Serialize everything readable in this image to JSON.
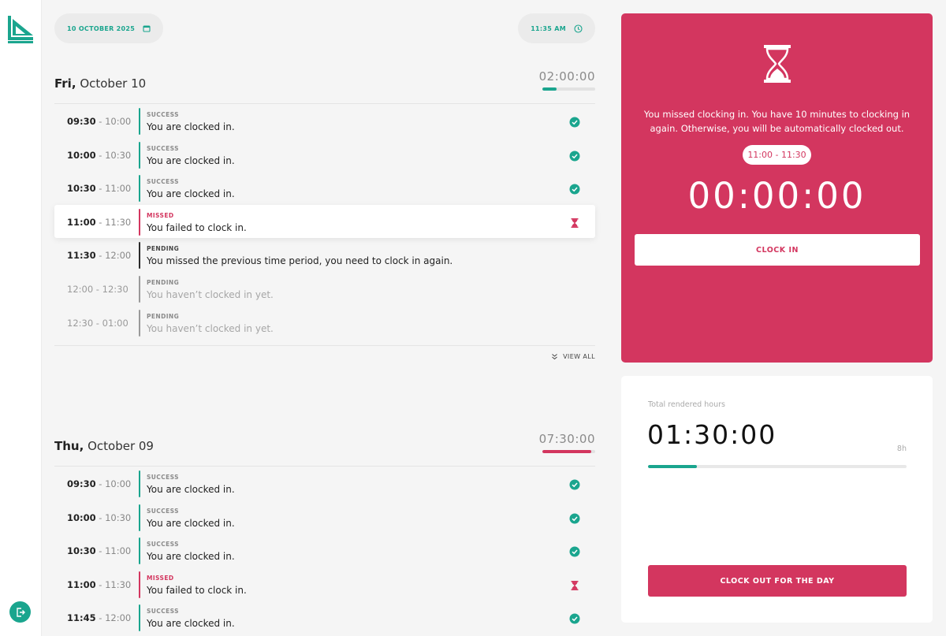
{
  "colors": {
    "accent": "#1aa58e",
    "missed": "#d3365f",
    "pending": "#2b2b2b",
    "pending_faded": "#a6a6a6"
  },
  "header": {
    "date": "10 OCTOBER 2025",
    "time": "11:35 AM"
  },
  "days": [
    {
      "weekday": "Fri,",
      "date": "October 10",
      "total": "02:00:00",
      "progress": 0.27,
      "progress_color": "#1aa58e",
      "entries": [
        {
          "start": "09:30",
          "end": "10:00",
          "status": "SUCCESS",
          "message": "You are clocked in.",
          "icon": "check-circle-icon"
        },
        {
          "start": "10:00",
          "end": "10:30",
          "status": "SUCCESS",
          "message": "You are clocked in.",
          "icon": "check-circle-icon"
        },
        {
          "start": "10:30",
          "end": "11:00",
          "status": "SUCCESS",
          "message": "You are clocked in.",
          "icon": "check-circle-icon"
        },
        {
          "start": "11:00",
          "end": "11:30",
          "status": "MISSED",
          "message": "You failed to clock in.",
          "icon": "hourglass-icon"
        },
        {
          "start": "11:30",
          "end": "12:00",
          "status": "PENDING",
          "message": "You missed the previous time period, you need to clock in again.",
          "icon": ""
        },
        {
          "start": "12:00",
          "end": "12:30",
          "status": "PENDING",
          "message": "You haven’t clocked in yet.",
          "icon": ""
        },
        {
          "start": "12:30",
          "end": "01:00",
          "status": "PENDING",
          "message": "You haven’t clocked in yet.",
          "icon": ""
        }
      ],
      "view_all": "VIEW ALL"
    },
    {
      "weekday": "Thu,",
      "date": "October 09",
      "total": "07:30:00",
      "progress": 0.92,
      "progress_color": "#d3365f",
      "entries": [
        {
          "start": "09:30",
          "end": "10:00",
          "status": "SUCCESS",
          "message": "You are clocked in.",
          "icon": "check-circle-icon"
        },
        {
          "start": "10:00",
          "end": "10:30",
          "status": "SUCCESS",
          "message": "You are clocked in.",
          "icon": "check-circle-icon"
        },
        {
          "start": "10:30",
          "end": "11:00",
          "status": "SUCCESS",
          "message": "You are clocked in.",
          "icon": "check-circle-icon"
        },
        {
          "start": "11:00",
          "end": "11:30",
          "status": "MISSED",
          "message": "You failed to clock in.",
          "icon": "hourglass-icon"
        },
        {
          "start": "11:45",
          "end": "12:00",
          "status": "SUCCESS",
          "message": "You are clocked in.",
          "icon": "check-circle-icon"
        }
      ]
    }
  ],
  "alert": {
    "icon": "hourglass-icon",
    "message": "You missed clocking in. You have 10 minutes to clocking in again. Otherwise, you will be automatically clocked out.",
    "range": "11:00 - 11:30",
    "countdown": "00:00:00",
    "button": "CLOCK IN"
  },
  "hours": {
    "label": "Total rendered hours",
    "value": "01:30:00",
    "target": "8h",
    "progress": 0.19,
    "button": "CLOCK OUT FOR THE DAY"
  },
  "sidebar": {
    "logo_icon": "brand-logo-icon",
    "logout_icon": "logout-icon"
  }
}
